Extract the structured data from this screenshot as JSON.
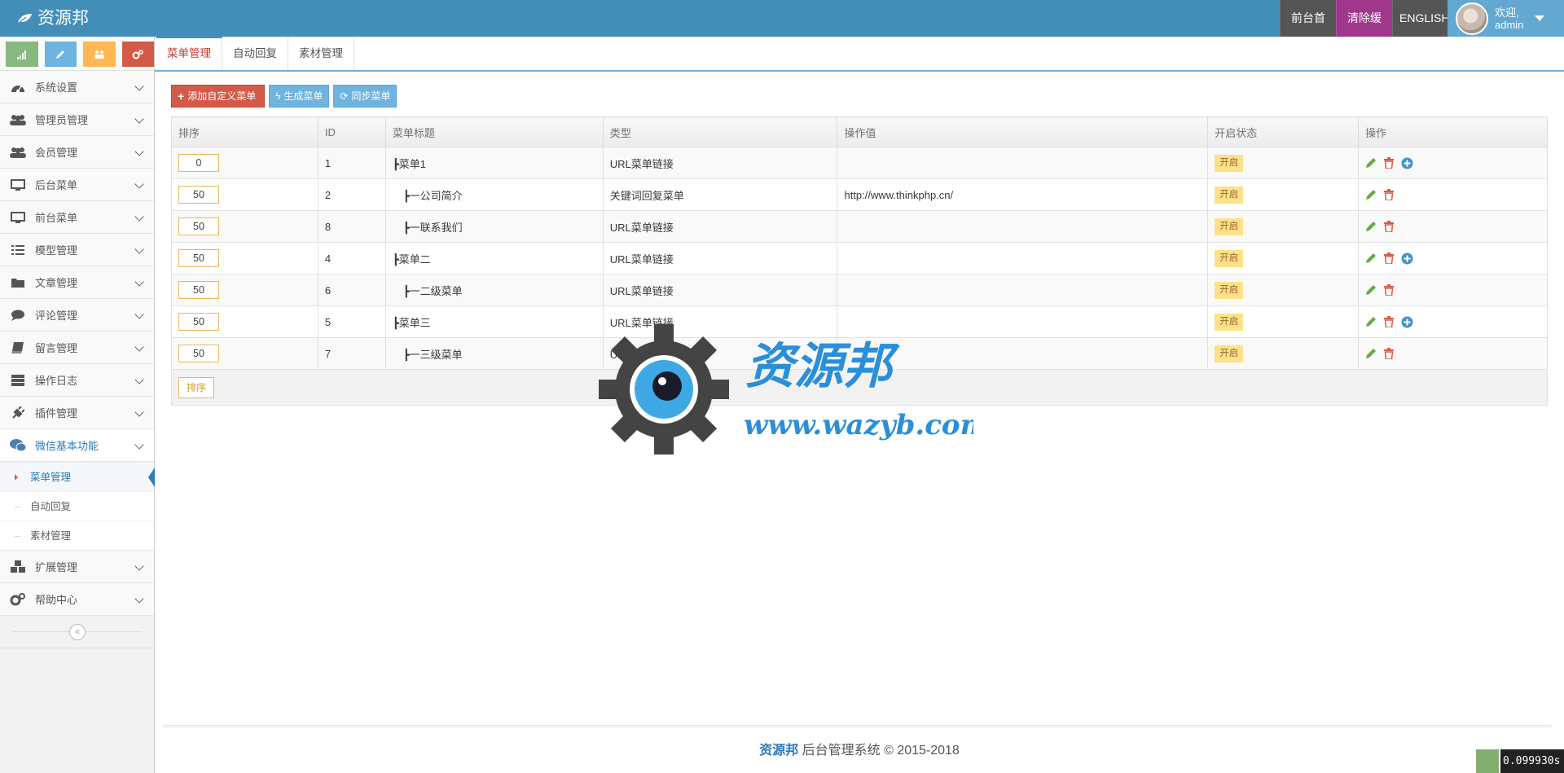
{
  "header": {
    "brand": "资源邦",
    "nav": {
      "home": "前台首页",
      "clear_cache": "清除缓存",
      "language": "ENGLISH"
    },
    "user": {
      "greeting": "欢迎,",
      "name": "admin"
    }
  },
  "sidebar": {
    "items": [
      {
        "label": "系统设置",
        "icon": "dashboard-icon"
      },
      {
        "label": "管理员管理",
        "icon": "users-icon"
      },
      {
        "label": "会员管理",
        "icon": "users-icon"
      },
      {
        "label": "后台菜单",
        "icon": "desktop-icon"
      },
      {
        "label": "前台菜单",
        "icon": "desktop-icon"
      },
      {
        "label": "模型管理",
        "icon": "list-icon"
      },
      {
        "label": "文章管理",
        "icon": "folder-icon"
      },
      {
        "label": "评论管理",
        "icon": "comment-icon"
      },
      {
        "label": "留言管理",
        "icon": "book-icon"
      },
      {
        "label": "操作日志",
        "icon": "server-icon"
      },
      {
        "label": "插件管理",
        "icon": "plug-icon"
      },
      {
        "label": "微信基本功能",
        "icon": "wechat-icon"
      }
    ],
    "submenu": [
      {
        "label": "菜单管理"
      },
      {
        "label": "自动回复"
      },
      {
        "label": "素材管理"
      }
    ],
    "items_after": [
      {
        "label": "扩展管理",
        "icon": "cubes-icon"
      },
      {
        "label": "帮助中心",
        "icon": "cogs-icon"
      }
    ],
    "collapse_glyph": "«"
  },
  "tabs": [
    {
      "label": "菜单管理"
    },
    {
      "label": "自动回复"
    },
    {
      "label": "素材管理"
    }
  ],
  "toolbar": {
    "add": "添加自定义菜单",
    "generate": "生成菜单",
    "sync": "同步菜单"
  },
  "table": {
    "headers": [
      "排序",
      "ID",
      "菜单标题",
      "类型",
      "操作值",
      "开启状态",
      "操作"
    ],
    "rows": [
      {
        "sort": "0",
        "id": "1",
        "title": "┣菜单1",
        "type": "URL菜单链接",
        "value": "",
        "status": "开启",
        "add": true
      },
      {
        "sort": "50",
        "id": "2",
        "title": "　┣一公司简介",
        "type": "关键词回复菜单",
        "value": "http://www.thinkphp.cn/",
        "status": "开启",
        "add": false
      },
      {
        "sort": "50",
        "id": "8",
        "title": "　┣一联系我们",
        "type": "URL菜单链接",
        "value": "",
        "status": "开启",
        "add": false
      },
      {
        "sort": "50",
        "id": "4",
        "title": "┣菜单二",
        "type": "URL菜单链接",
        "value": "",
        "status": "开启",
        "add": true
      },
      {
        "sort": "50",
        "id": "6",
        "title": "　┣一二级菜单",
        "type": "URL菜单链接",
        "value": "",
        "status": "开启",
        "add": false
      },
      {
        "sort": "50",
        "id": "5",
        "title": "┣菜单三",
        "type": "URL菜单链接",
        "value": "",
        "status": "开启",
        "add": true
      },
      {
        "sort": "50",
        "id": "7",
        "title": "　┣一三级菜单",
        "type": "URL菜单链接",
        "value": "",
        "status": "开启",
        "add": false
      }
    ],
    "sort_button": "排序"
  },
  "watermark": {
    "title": "资源邦",
    "url": "www.wazyb.com"
  },
  "footer": {
    "brand": "资源邦",
    "text": " 后台管理系统 © 2015-2018"
  },
  "perf": "0.099930s",
  "colors": {
    "header": "#438eb9",
    "accent": "#2b7dbc",
    "danger": "#d15b47",
    "info": "#6fb3e0",
    "warning": "#fee188"
  }
}
